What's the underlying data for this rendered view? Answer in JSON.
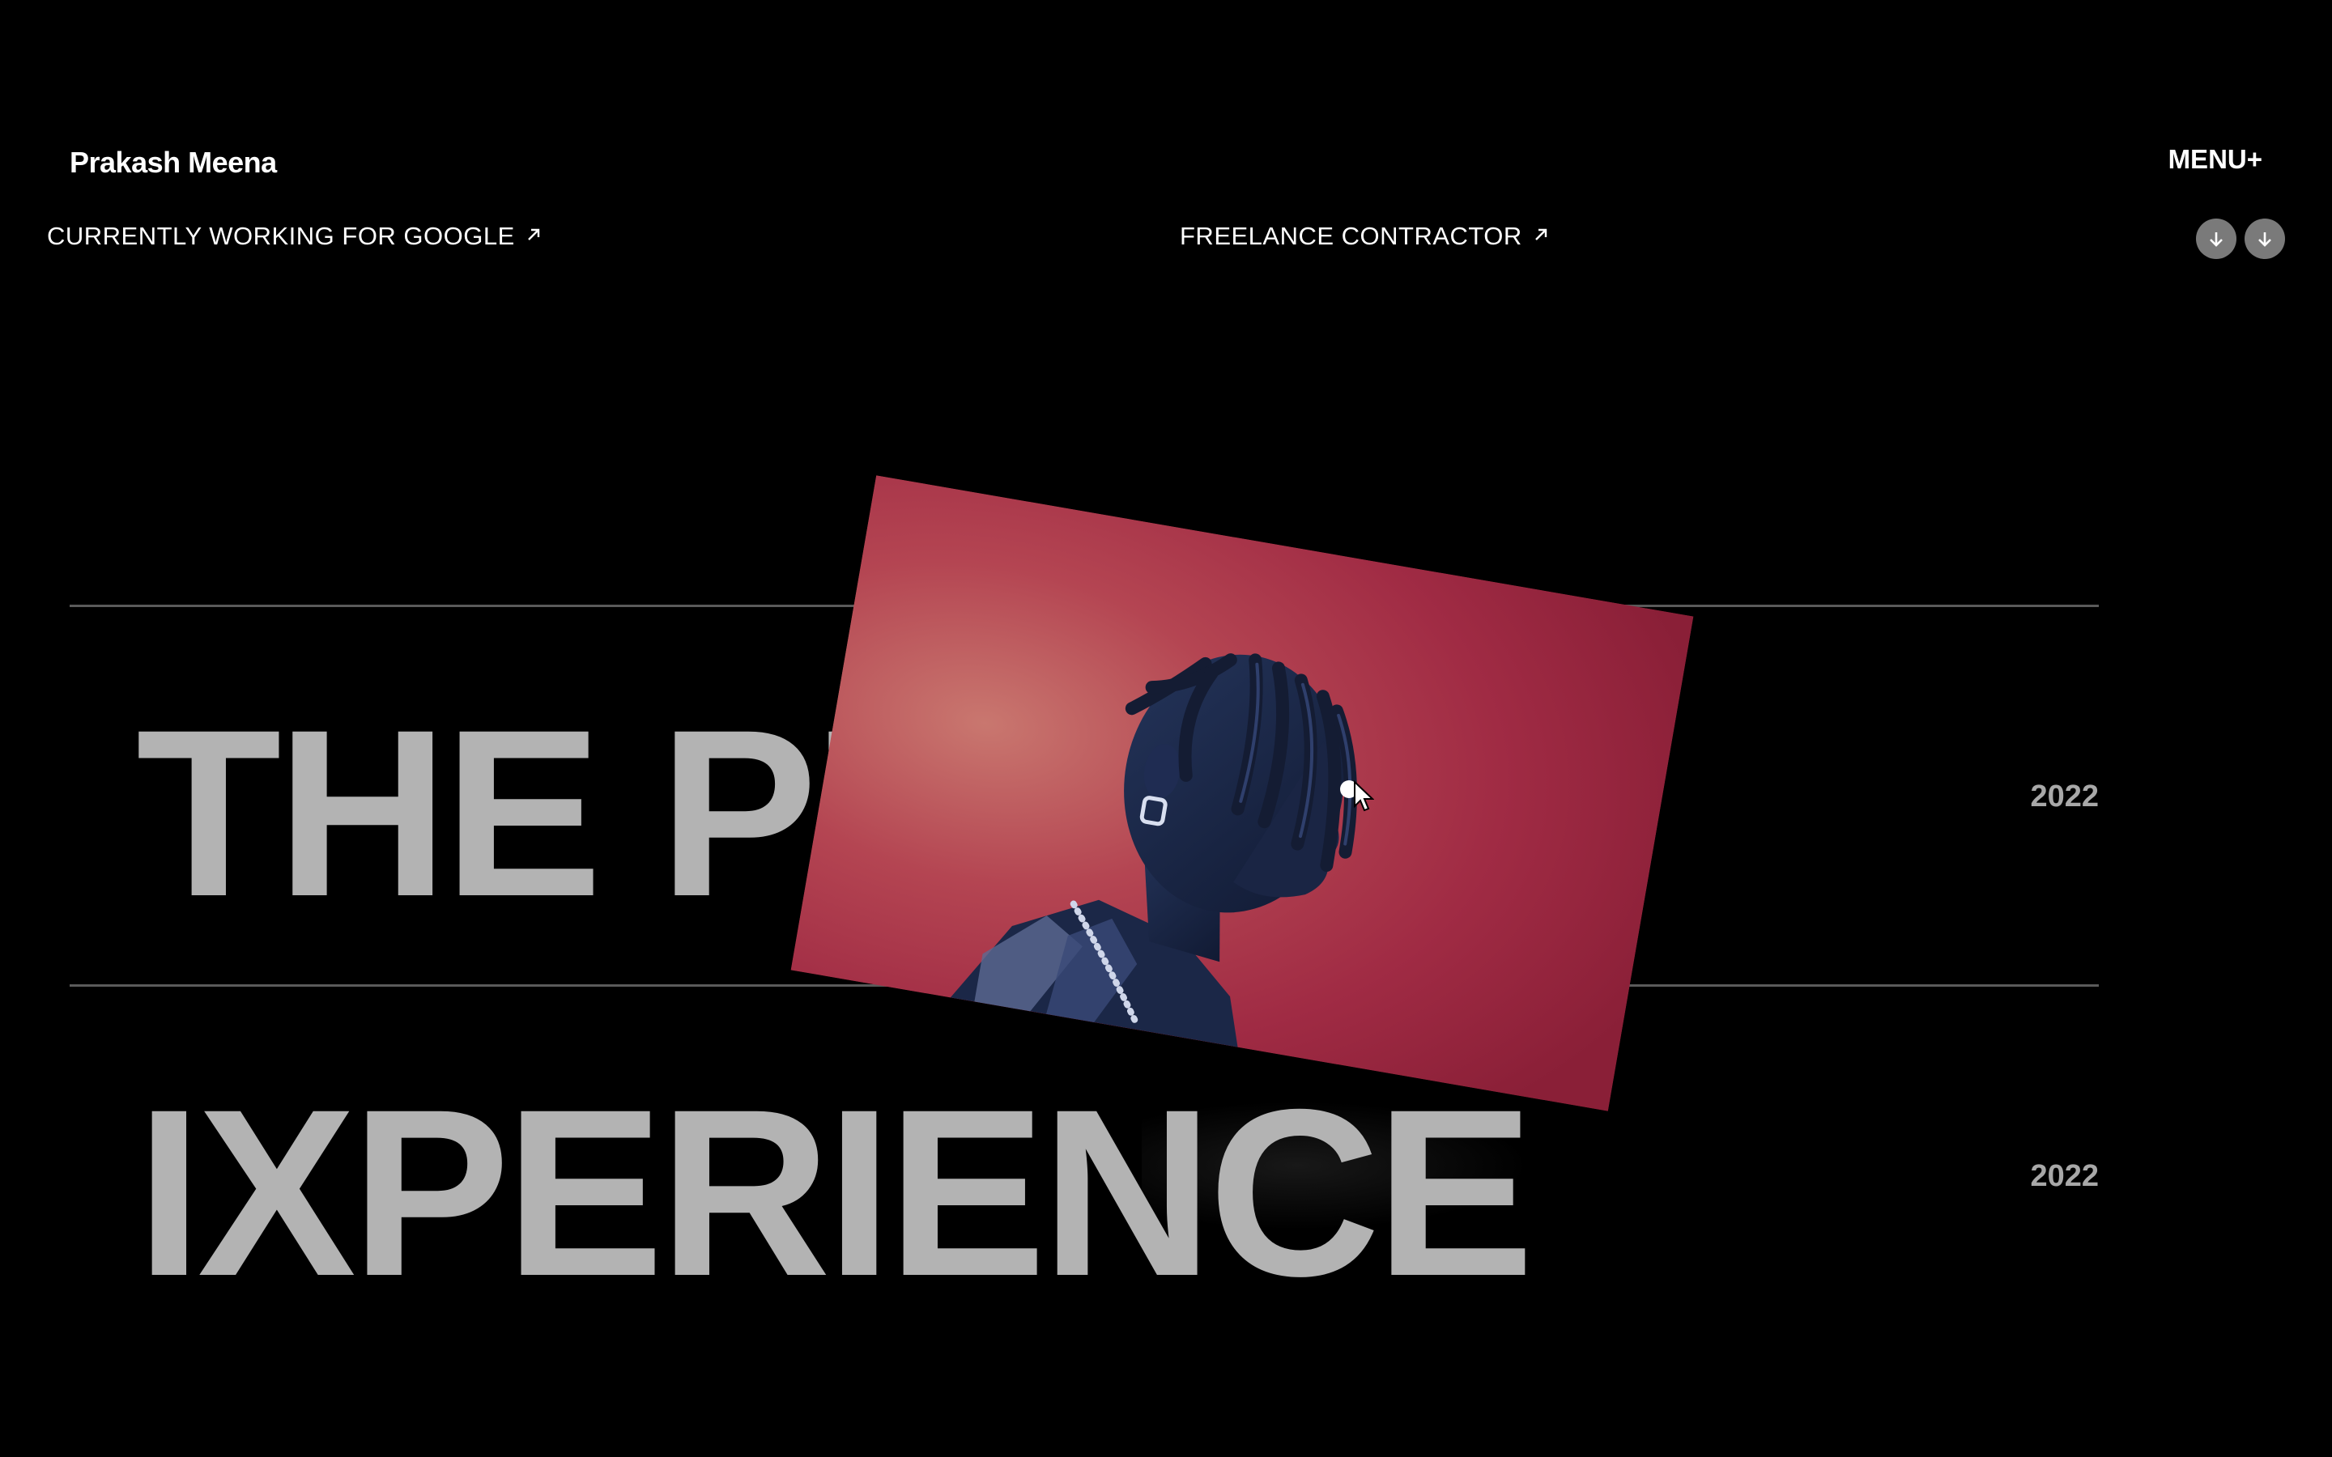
{
  "header": {
    "brand": "Prakash Meena",
    "menu_label": "MENU+"
  },
  "ticker": {
    "items": [
      {
        "label": "CURRENTLY WORKING FOR GOOGLE",
        "icon": "arrow-up-right-icon"
      },
      {
        "label": "FREELANCE CONTRACTOR",
        "icon": "arrow-up-right-icon"
      }
    ]
  },
  "scroll_buttons": [
    {
      "icon": "arrow-down-icon"
    },
    {
      "icon": "arrow-down-icon"
    }
  ],
  "projects": [
    {
      "title": "THE PL",
      "year": "2022"
    },
    {
      "title": "IXPERIENCE",
      "year": "2022"
    }
  ],
  "colors": {
    "background": "#000000",
    "title_gray": "#b3b3b3",
    "photo_backdrop": "#a42a43",
    "rule": "#5a5a5a"
  }
}
